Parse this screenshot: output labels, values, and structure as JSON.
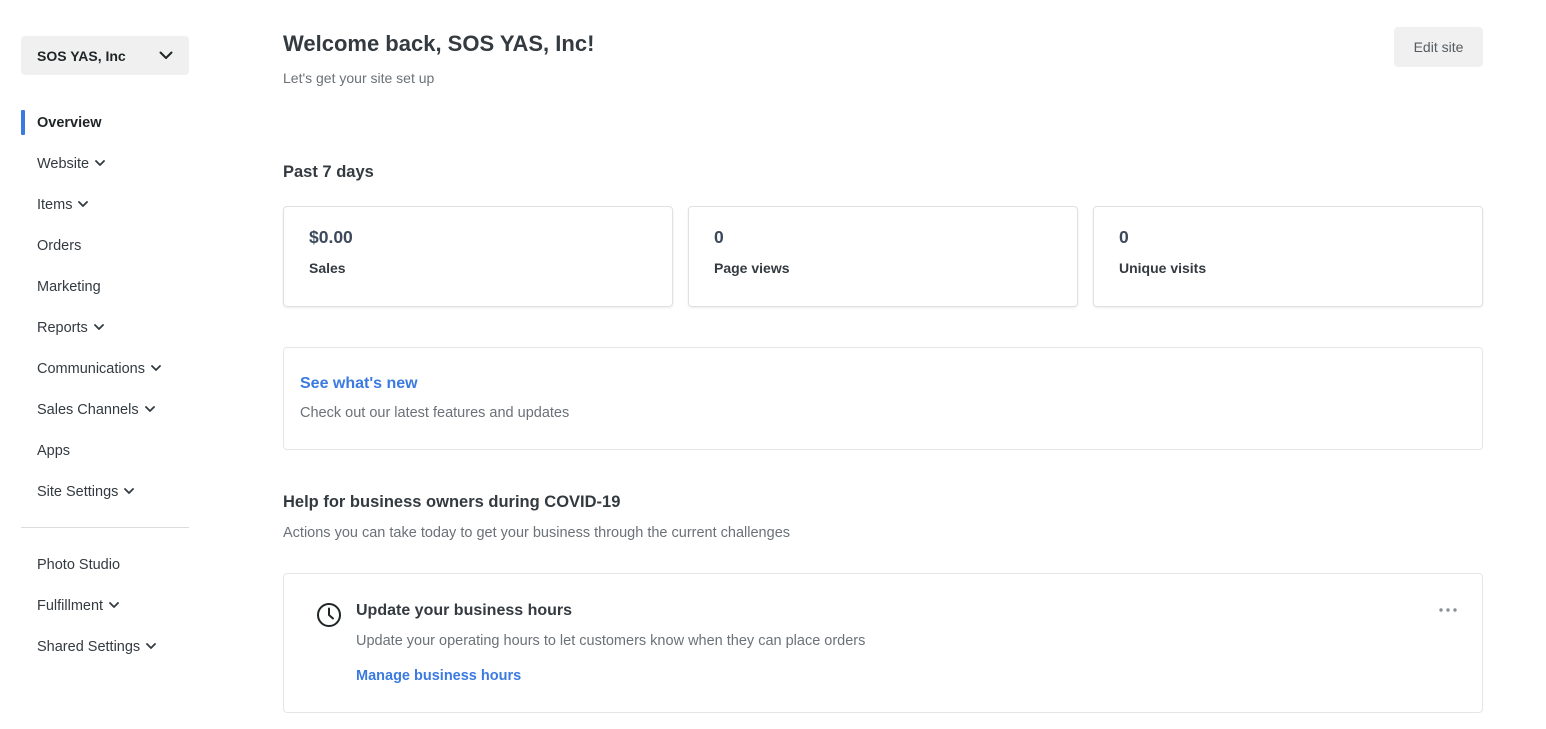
{
  "sidebar": {
    "account_name": "SOS YAS, Inc",
    "nav_items": [
      {
        "label": "Overview",
        "active": true,
        "has_chevron": false
      },
      {
        "label": "Website",
        "active": false,
        "has_chevron": true
      },
      {
        "label": "Items",
        "active": false,
        "has_chevron": true
      },
      {
        "label": "Orders",
        "active": false,
        "has_chevron": false
      },
      {
        "label": "Marketing",
        "active": false,
        "has_chevron": false
      },
      {
        "label": "Reports",
        "active": false,
        "has_chevron": true
      },
      {
        "label": "Communications",
        "active": false,
        "has_chevron": true
      },
      {
        "label": "Sales Channels",
        "active": false,
        "has_chevron": true
      },
      {
        "label": "Apps",
        "active": false,
        "has_chevron": false
      },
      {
        "label": "Site Settings",
        "active": false,
        "has_chevron": true
      }
    ],
    "secondary_items": [
      {
        "label": "Photo Studio",
        "has_chevron": false
      },
      {
        "label": "Fulfillment",
        "has_chevron": true
      },
      {
        "label": "Shared Settings",
        "has_chevron": true
      }
    ]
  },
  "header": {
    "title": "Welcome back, SOS YAS, Inc!",
    "subtitle": "Let's get your site set up",
    "edit_button": "Edit site"
  },
  "stats": {
    "period_title": "Past 7 days",
    "cards": [
      {
        "value": "$0.00",
        "label": "Sales"
      },
      {
        "value": "0",
        "label": "Page views"
      },
      {
        "value": "0",
        "label": "Unique visits"
      }
    ]
  },
  "whats_new": {
    "title": "See what's new",
    "description": "Check out our latest features and updates"
  },
  "covid": {
    "title": "Help for business owners during COVID-19",
    "description": "Actions you can take today to get your business through the current challenges",
    "task": {
      "icon": "clock-icon",
      "title": "Update your business hours",
      "description": "Update your operating hours to let customers know when they can place orders",
      "link": "Manage business hours"
    }
  },
  "colors": {
    "accent": "#3b7ae0",
    "text": "#333a40",
    "muted": "#6b7177"
  }
}
